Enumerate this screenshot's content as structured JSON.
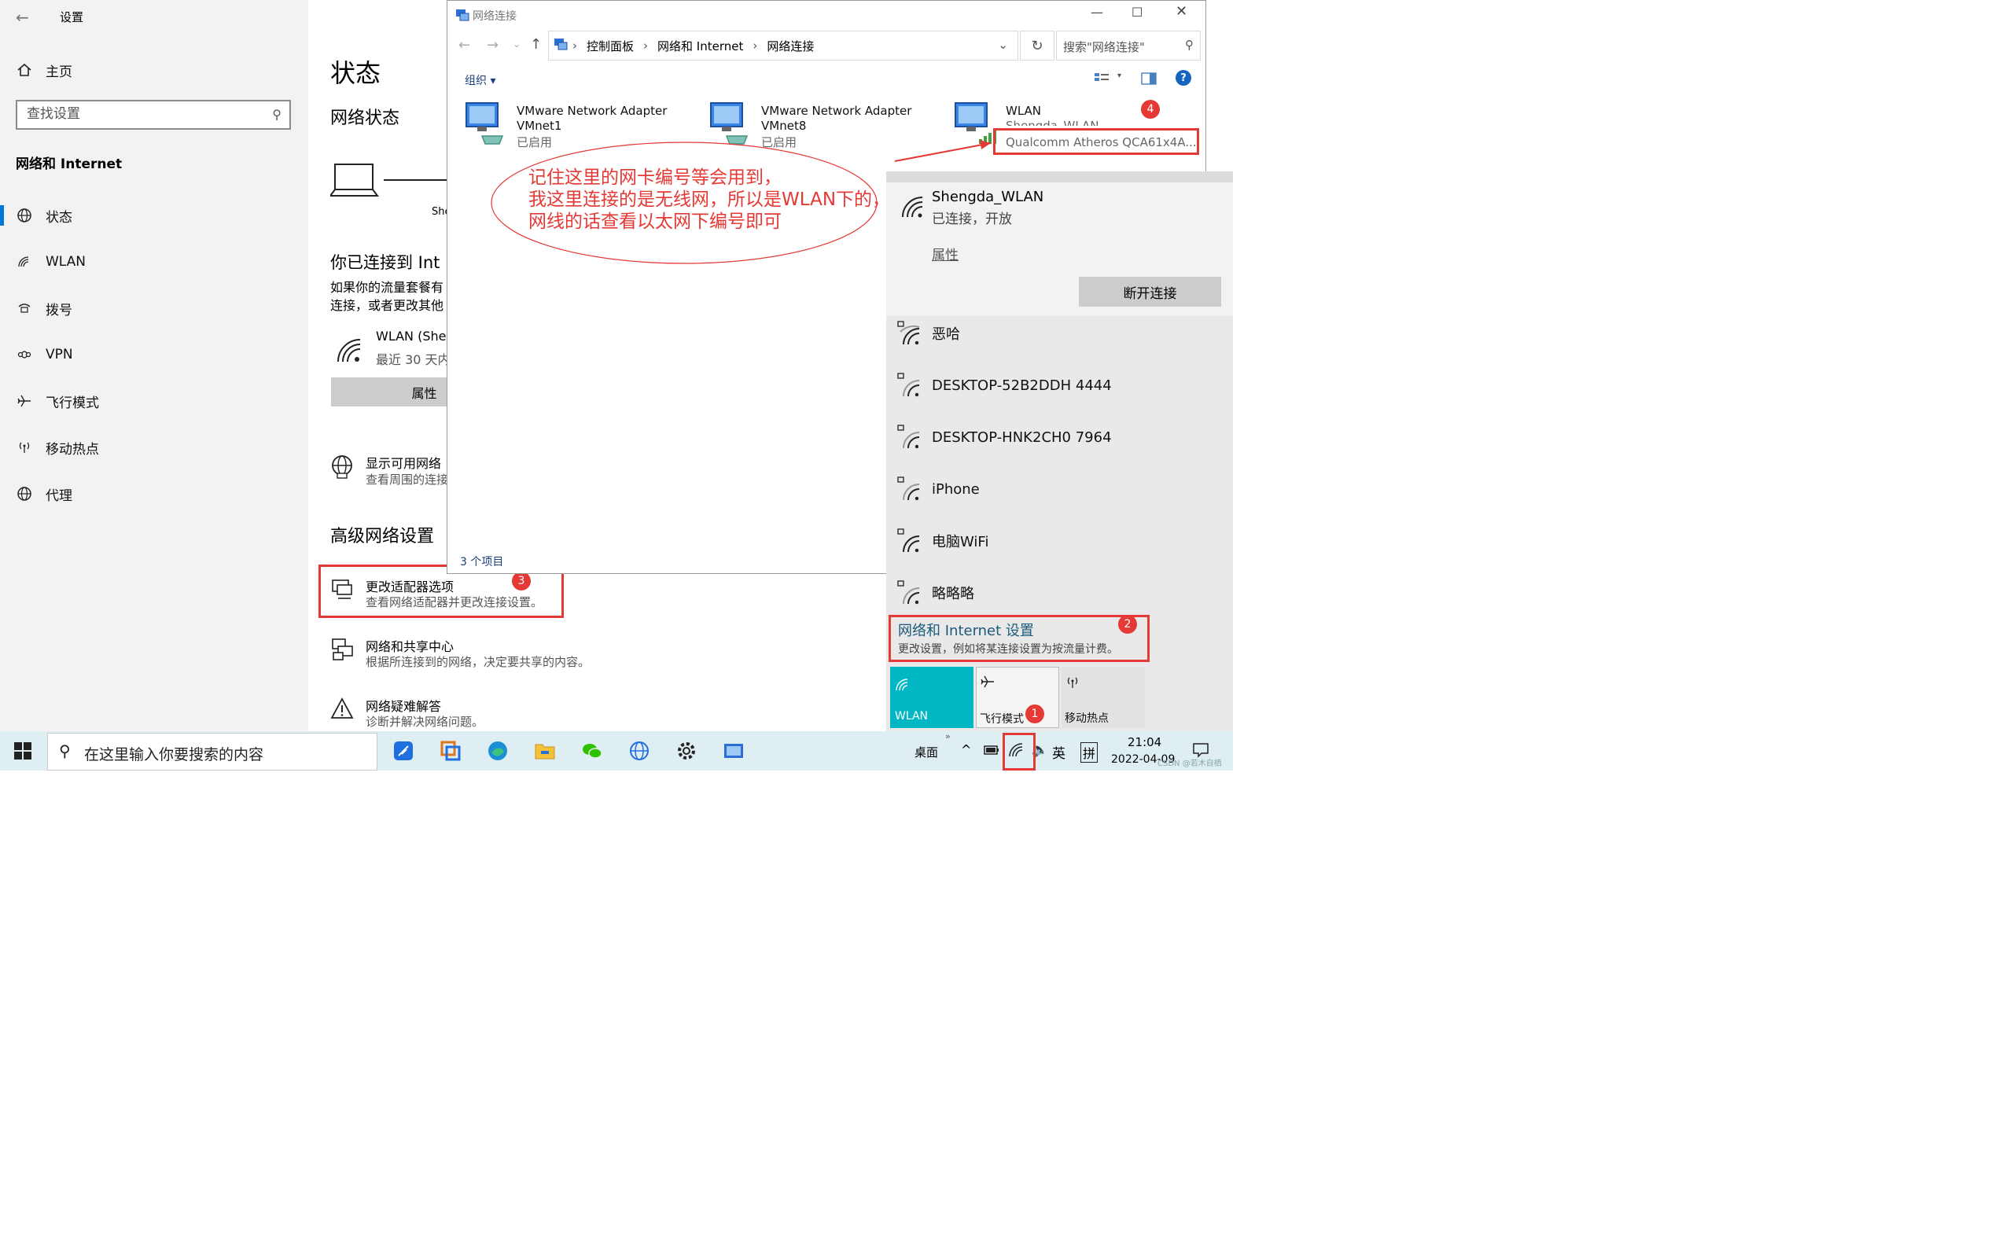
{
  "settings": {
    "window_title": "设置",
    "home": "主页",
    "search_placeholder": "查找设置",
    "category": "网络和 Internet",
    "nav": [
      {
        "label": "状态",
        "icon": "globe-icon"
      },
      {
        "label": "WLAN",
        "icon": "wifi-icon"
      },
      {
        "label": "拨号",
        "icon": "dialup-icon"
      },
      {
        "label": "VPN",
        "icon": "vpn-icon"
      },
      {
        "label": "飞行模式",
        "icon": "airplane-icon"
      },
      {
        "label": "移动热点",
        "icon": "hotspot-icon"
      },
      {
        "label": "代理",
        "icon": "globe-icon"
      }
    ],
    "page_title": "状态",
    "network_status": "网络状态",
    "status_network_name": "She",
    "connected_heading": "你已连接到 Int",
    "connected_desc_1": "如果你的流量套餐有",
    "connected_desc_2": "连接，或者更改其他",
    "wlan_name": "WLAN (Sher",
    "wlan_usage": "最近 30 天内",
    "properties_button": "属性",
    "show_networks_title": "显示可用网络",
    "show_networks_desc": "查看周围的连接",
    "advanced_heading": "高级网络设置",
    "adv": [
      {
        "title": "更改适配器选项",
        "desc": "查看网络适配器并更改连接设置。"
      },
      {
        "title": "网络和共享中心",
        "desc": "根据所连接到的网络，决定要共享的内容。"
      },
      {
        "title": "网络疑难解答",
        "desc": "诊断并解决网络问题。"
      }
    ]
  },
  "netwin": {
    "title": "网络连接",
    "breadcrumb": [
      "控制面板",
      "网络和 Internet",
      "网络连接"
    ],
    "search_placeholder": "搜索\"网络连接\"",
    "organize": "组织",
    "items_count": "3 个项目",
    "adapters": [
      {
        "name": "VMware Network Adapter",
        "name2": "VMnet1",
        "status": "已启用"
      },
      {
        "name": "VMware Network Adapter",
        "name2": "VMnet8",
        "status": "已启用"
      },
      {
        "name": "WLAN",
        "name2": "Shengda_WLAN",
        "status": "Qualcomm Atheros QCA61x4A..."
      }
    ]
  },
  "annotation": {
    "line1": "记住这里的网卡编号等会用到，",
    "line2": "我这里连接的是无线网，所以是WLAN下的，",
    "line3": "网线的话查看以太网下编号即可"
  },
  "badges": [
    "1",
    "2",
    "3",
    "4"
  ],
  "flyout": {
    "connected_name": "Shengda_WLAN",
    "connected_status": "已连接，开放",
    "properties": "属性",
    "disconnect": "断开连接",
    "networks": [
      "恶哈",
      "DESKTOP-52B2DDH 4444",
      "DESKTOP-HNK2CH0 7964",
      "iPhone",
      "电脑WiFi",
      "略略略"
    ],
    "settings_title": "网络和 Internet 设置",
    "settings_desc": "更改设置，例如将某连接设置为按流量计费。",
    "tiles": [
      "WLAN",
      "飞行模式",
      "移动热点"
    ]
  },
  "taskbar": {
    "search_placeholder": "在这里输入你要搜索的内容",
    "desktop": "桌面",
    "lang": "英",
    "ime": "拼",
    "time": "21:04",
    "date": "2022-04-09",
    "watermark": "CSDN @若木自栖"
  },
  "colors": {
    "accent": "#0078d7",
    "tile_active": "#00b7c3",
    "red": "#e53935"
  }
}
